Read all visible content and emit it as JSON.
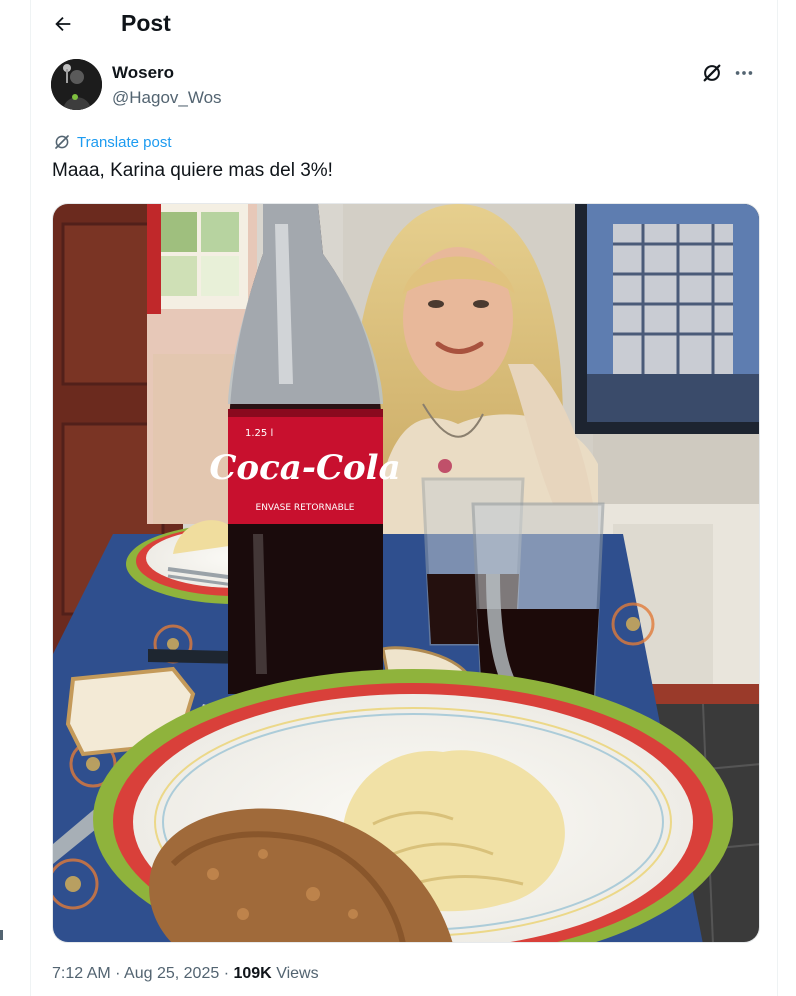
{
  "header": {
    "title": "Post",
    "back_icon": "arrow-left-icon"
  },
  "author": {
    "name": "Wosero",
    "handle": "@Hagov_Wos",
    "avatar_icon": "avatar"
  },
  "actions": {
    "grok_icon": "grok-icon",
    "more_icon": "more-horizontal-icon"
  },
  "translate": {
    "label": "Translate post",
    "icon": "translate-icon",
    "color": "#1d9bf0"
  },
  "post": {
    "text": "Maaa, Karina quiere mas del 3%!"
  },
  "media": {
    "description_icon": "photo",
    "bottle_label": "Coca-Cola",
    "bottle_sub": "ENVASE RETORNABLE",
    "bottle_size": "1.25 l"
  },
  "meta": {
    "time": "7:12 AM",
    "separator": "·",
    "date": "Aug 25, 2025",
    "views_count": "109K",
    "views_label": "Views"
  }
}
